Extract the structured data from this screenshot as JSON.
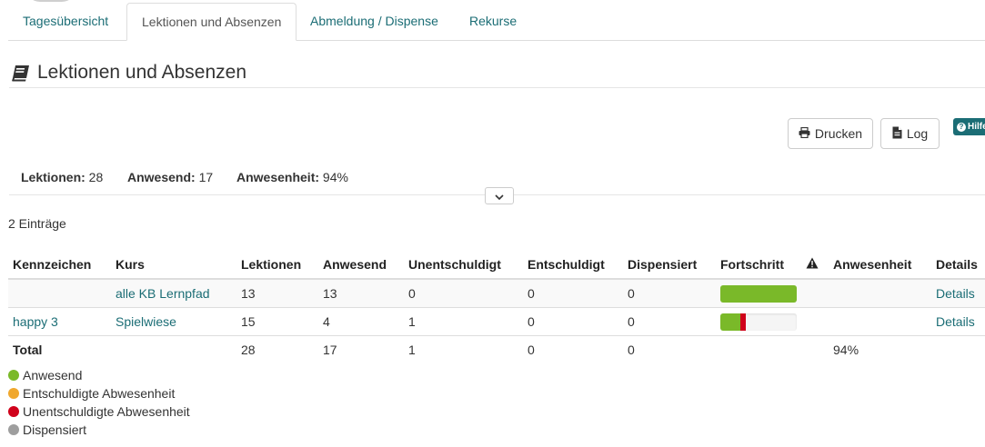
{
  "tabs": [
    {
      "label": "Tagesübersicht"
    },
    {
      "label": "Lektionen und Absenzen"
    },
    {
      "label": "Abmeldung / Dispense"
    },
    {
      "label": "Rekurse"
    }
  ],
  "page": {
    "title": "Lektionen und Absenzen",
    "icon": "book-icon"
  },
  "toolbar": {
    "print_label": "Drucken",
    "log_label": "Log",
    "help_label": "Hilfe"
  },
  "summary": {
    "lessons_label": "Lektionen:",
    "lessons_value": "28",
    "present_label": "Anwesend:",
    "present_value": "17",
    "attendance_label": "Anwesenheit:",
    "attendance_value": "94%"
  },
  "entries_count": "2 Einträge",
  "table": {
    "headers": [
      "Kennzeichen",
      "Kurs",
      "Lektionen",
      "Anwesend",
      "Unentschuldigt",
      "Entschuldigt",
      "Dispensiert",
      "Fortschritt",
      "Anwesenheit",
      "Details"
    ],
    "rows": [
      {
        "kennzeichen": "",
        "kurs": "alle KB Lernpfad",
        "lektionen": "13",
        "anwesend": "13",
        "unentschuldigt": "0",
        "entschuldigt": "0",
        "dispensiert": "0",
        "progress": {
          "present": 1.0,
          "unexcused": 0.0
        },
        "anwesenheit": "",
        "details": "Details"
      },
      {
        "kennzeichen": "happy 3",
        "kurs": "Spielwiese",
        "lektionen": "15",
        "anwesend": "4",
        "unentschuldigt": "1",
        "entschuldigt": "0",
        "dispensiert": "0",
        "progress": {
          "present": 0.267,
          "unexcused": 0.067
        },
        "anwesenheit": "",
        "details": "Details"
      }
    ],
    "total": {
      "label": "Total",
      "lektionen": "28",
      "anwesend": "17",
      "unentschuldigt": "1",
      "entschuldigt": "0",
      "dispensiert": "0",
      "anwesenheit": "94%"
    }
  },
  "legend": [
    {
      "label": "Anwesend",
      "color": "#7ab929"
    },
    {
      "label": "Entschuldigte Abwesenheit",
      "color": "#f0a82e"
    },
    {
      "label": "Unentschuldigte Abwesenheit",
      "color": "#d0021b"
    },
    {
      "label": "Dispensiert",
      "color": "#9e9e9e"
    }
  ],
  "colors": {
    "accent": "#1b6d75",
    "present": "#7ab929",
    "unexcused": "#d0021b"
  }
}
